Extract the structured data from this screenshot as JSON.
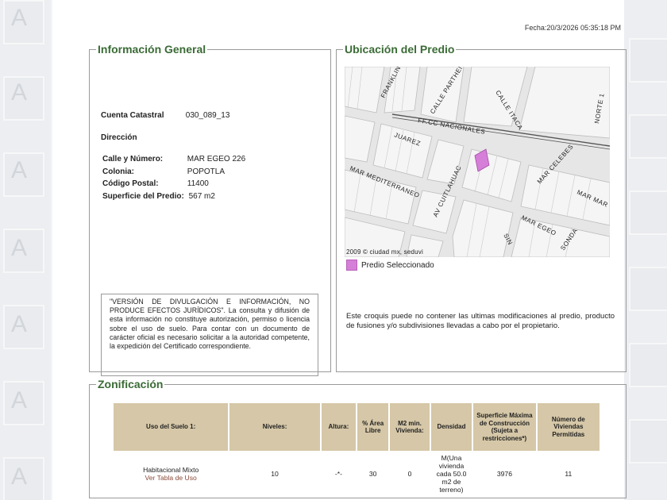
{
  "header": {
    "fecha": "Fecha:20/3/2026 05:35:18 PM"
  },
  "info_general": {
    "title": "Información General",
    "cuenta_label": "Cuenta Catastral",
    "cuenta_value": "030_089_13",
    "direccion_label": "Dirección",
    "calle_label": "Calle y Número:",
    "calle_value": "MAR EGEO 226",
    "colonia_label": "Colonia:",
    "colonia_value": "POPOTLA",
    "cp_label": "Código Postal:",
    "cp_value": "11400",
    "superficie_label": "Superficie del Predio:",
    "superficie_value": "567 m2",
    "disclaimer": "\"VERSIÓN DE DIVULGACIÓN E INFORMACIÓN, NO PRODUCE EFECTOS JURÍDICOS\". La consulta y difusión de esta información no constituye autorización, permiso o licencia sobre el uso de suelo. Para contar con un documento de carácter oficial es necesario solicitar a la autoridad competente, la expedición del Certificado correspondiente."
  },
  "ubicacion": {
    "title": "Ubicación del Predio",
    "map_labels": {
      "franklin": "FRANKLIN",
      "parthenon": "CALLE PARTHENON",
      "itaca": "CALLE ITACA",
      "norte": "NORTE 1",
      "ffcc": "FF.CC NACIONALES",
      "juarez": "JUAREZ",
      "mediterraneo": "MAR MEDITERRANEO",
      "cuitlahuac": "AV CUITLAHUAC",
      "celebes": "MAR CELEBES",
      "marmar": "MAR MAR",
      "egeo": "MAR EGEO",
      "sin": "SIN",
      "sonda": "SONDA",
      "copyright": "2009 © ciudad mx, seduvi"
    },
    "legend": "Predio Seleccionado",
    "note": "Este croquis puede no contener las ultimas modificaciones al predio, producto de fusiones y/o subdivisiones llevadas a cabo por el propietario.",
    "colors": {
      "predio": "#d67fd8"
    }
  },
  "zonificacion": {
    "title": "Zonificación",
    "headers": [
      "Uso del Suelo 1:",
      "Niveles:",
      "Altura:",
      "% Área Libre",
      "M2 min. Vivienda:",
      "Densidad",
      "Superficie Máxima de Construcción (Sujeta a restricciones*)",
      "Número de Viviendas Permitidas"
    ],
    "row": {
      "uso": "Habitacional Mixto",
      "uso_link": "Ver Tabla de Uso",
      "niveles": "10",
      "altura": "-*-",
      "area_libre": "30",
      "m2min": "0",
      "densidad": "M(Una vivienda cada 50.0 m2 de terreno)",
      "superficie": "3976",
      "viviendas": "11"
    },
    "colors": {
      "header_bg": "#d5c7a7"
    }
  }
}
